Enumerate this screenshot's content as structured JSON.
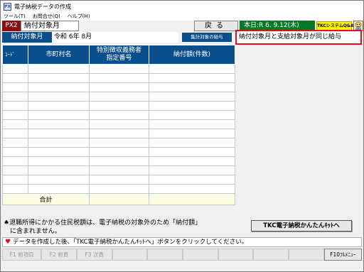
{
  "window": {
    "title": "電子納税データの作成"
  },
  "app_icon": {
    "text": "PX"
  },
  "menu": {
    "items": [
      "ツール(T)",
      "お問合せ(Q)",
      "ヘルプ(H)"
    ]
  },
  "header": {
    "screen_id": "PX2",
    "screen_title": "納付対象月",
    "back_label": "戻る",
    "today": "本日:R 6. 9.12(木)",
    "tkc_qa": "TKCシステムQ&A"
  },
  "period": {
    "label": "納付対象月",
    "value": "令和 6年 8月",
    "sum_target_label": "集計対象の給与",
    "notice": "納付対象月と支給対象月が同じ給与"
  },
  "table": {
    "headers": {
      "code": "ｺｰﾄﾞ",
      "city": "市町村名",
      "special_line1": "特別徴収義務者",
      "special_line2": "指定番号",
      "amount": "納付額(件数)"
    },
    "empty_rows": 14,
    "total_label": "合計"
  },
  "notes": {
    "line1": "♠退職所得にかかる住民税額は、電子納税の対象外のため「納付額」",
    "line2": "　に含まれません。",
    "kantan_label": "TKC電子納税かんたんｷｯﾄへ"
  },
  "message": {
    "text": "データを作成した後、「TKC電子納税かんたんｷｯﾄへ」ボタンをクリックしてください。"
  },
  "fkeys": [
    {
      "label": "F1 前項目",
      "enabled": false
    },
    {
      "label": "F2 前頁",
      "enabled": false
    },
    {
      "label": "F3 次頁",
      "enabled": false
    },
    {
      "label": "",
      "enabled": false
    },
    {
      "label": "",
      "enabled": false
    },
    {
      "label": "",
      "enabled": false
    },
    {
      "label": "",
      "enabled": false
    },
    {
      "label": "",
      "enabled": false
    },
    {
      "label": "",
      "enabled": false
    },
    {
      "label": "F10ﾌﾙﾒﾆｭｰ",
      "enabled": true
    }
  ],
  "colors": {
    "header_blue": "#0a4f8c",
    "screen_id_red": "#8b0e0e",
    "today_green": "#067a22",
    "qa_yellow": "#fff200",
    "notice_red": "#e0101c"
  }
}
